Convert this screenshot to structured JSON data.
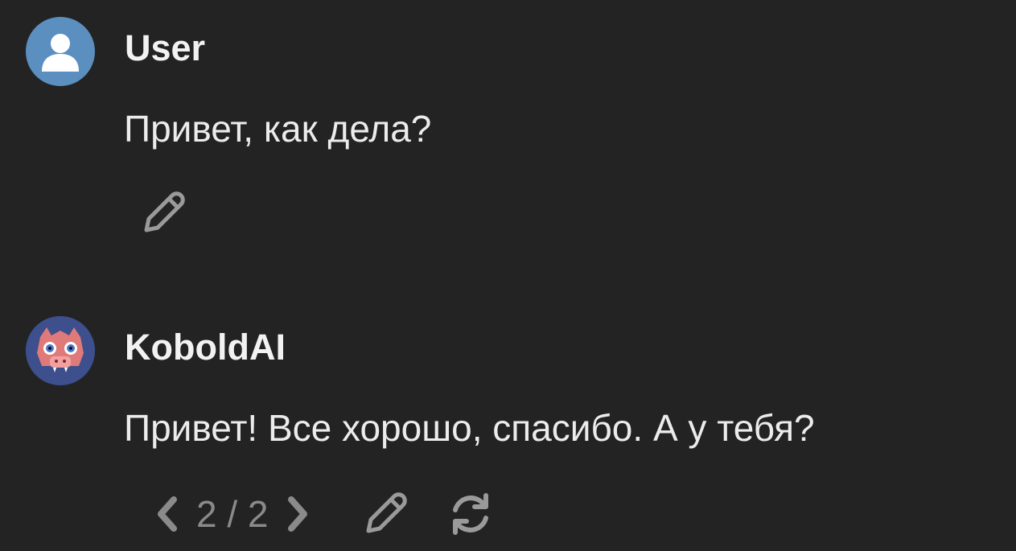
{
  "messages": [
    {
      "author": "User",
      "text": "Привет, как дела?",
      "avatar_icon": "user-avatar-icon",
      "actions": [
        "edit-icon"
      ]
    },
    {
      "author": "KoboldAI",
      "text": "Привет! Все хорошо, спасибо. А у тебя?",
      "avatar_icon": "kobold-avatar-icon",
      "swipe": {
        "current": "2",
        "separator": "/",
        "total": "2",
        "label": "2 / 2"
      },
      "actions": [
        "chevron-left-icon",
        "chevron-right-icon",
        "edit-icon",
        "regenerate-icon"
      ]
    }
  ],
  "colors": {
    "background": "#232323",
    "text": "#ececec",
    "muted": "#8a8a8a",
    "user_avatar_bg": "#5b8fc0",
    "kobold_avatar_bg": "#3d4f8c"
  }
}
